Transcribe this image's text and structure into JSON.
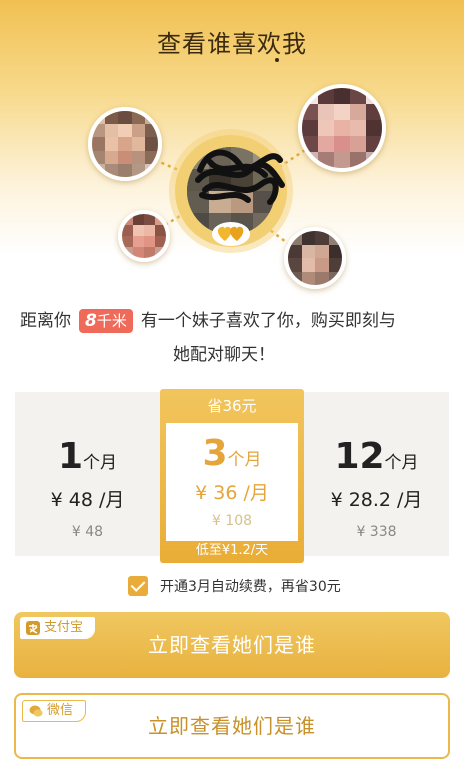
{
  "header": {
    "title": "查看谁喜欢我"
  },
  "message": {
    "prefix": "距离你",
    "distance": "8",
    "distance_unit": "千米",
    "line1_rest": "有一个妹子喜欢了你，购买即刻与",
    "line2": "她配对聊天！"
  },
  "plans": [
    {
      "months": "1",
      "unit": "个月",
      "price": "¥ 48 /月",
      "original": "¥ 48"
    },
    {
      "badge": "省36元",
      "months": "3",
      "unit": "个月",
      "price": "¥ 36 /月",
      "original": "¥ 108",
      "daily": "低至¥1.2/天",
      "selected": true
    },
    {
      "months": "12",
      "unit": "个月",
      "price": "¥ 28.2 /月",
      "original": "¥ 338"
    }
  ],
  "autorenew": {
    "checked": true,
    "label": "开通3月自动续费，再省30元"
  },
  "buttons": {
    "alipay": {
      "tag": "支付宝",
      "label": "立即查看她们是谁"
    },
    "wechat": {
      "tag": "微信",
      "label": "立即查看她们是谁"
    }
  },
  "icons": {
    "alipay": "alipay-icon",
    "wechat": "wechat-icon",
    "heart": "double-heart-icon",
    "check": "check-icon"
  },
  "colors": {
    "gold": "#e9ac3b",
    "badge_red": "#f06a5a",
    "header_gradient_top": "#f1c052"
  }
}
